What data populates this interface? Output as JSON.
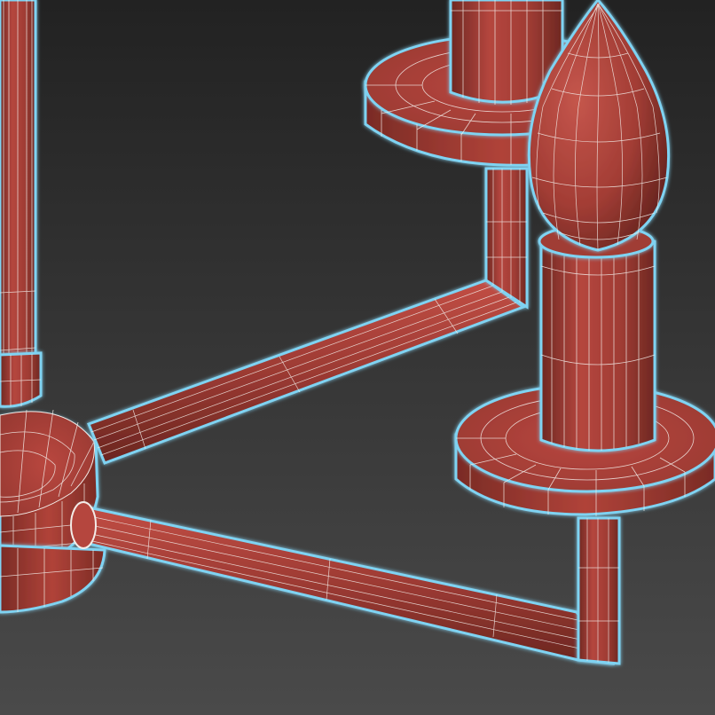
{
  "scene": {
    "subject": "chandelier-wireframe-render",
    "colors": {
      "background_top": "#232323",
      "background_bottom": "#4a4a4a",
      "surface_light": "#b5463e",
      "surface_mid": "#9b3a33",
      "surface_dark": "#6e2822",
      "wire": "#f3ece8",
      "selection_glow": "#7fd3f2"
    }
  }
}
